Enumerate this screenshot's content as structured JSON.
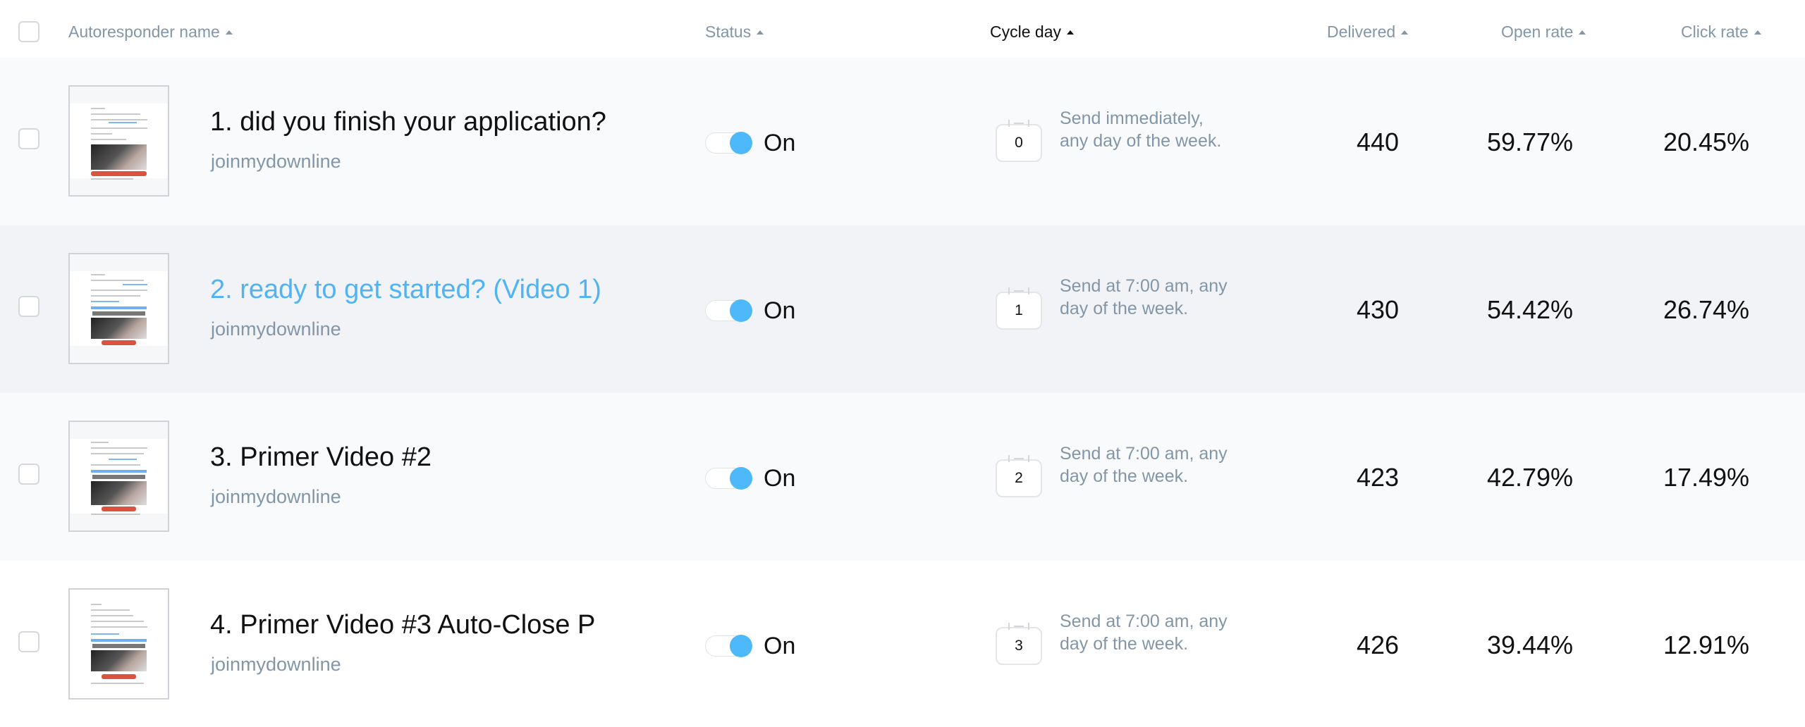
{
  "header": {
    "columns": [
      {
        "label": "Autoresponder name",
        "sorted": false
      },
      {
        "label": "Status",
        "sorted": false
      },
      {
        "label": "Cycle day",
        "sorted": true
      },
      {
        "label": "Delivered",
        "sorted": false
      },
      {
        "label": "Open rate",
        "sorted": false
      },
      {
        "label": "Click rate",
        "sorted": false
      }
    ]
  },
  "colors": {
    "accent": "#4db8fa",
    "link": "#4fb3f4",
    "muted": "#8396a8",
    "cta": "#d9533f"
  },
  "rows": [
    {
      "name": "1. did you finish your application?",
      "sender": "joinmydownline",
      "status": "On",
      "status_on": true,
      "cycle_day": "0",
      "schedule": "Send immediately, any day of the week.",
      "delivered": "440",
      "open_rate": "59.77%",
      "click_rate": "20.45%",
      "hovered": false
    },
    {
      "name": "2. ready to get started? (Video 1)",
      "sender": "joinmydownline",
      "status": "On",
      "status_on": true,
      "cycle_day": "1",
      "schedule": "Send at 7:00 am, any day of the week.",
      "delivered": "430",
      "open_rate": "54.42%",
      "click_rate": "26.74%",
      "hovered": true
    },
    {
      "name": "3. Primer Video #2",
      "sender": "joinmydownline",
      "status": "On",
      "status_on": true,
      "cycle_day": "2",
      "schedule": "Send at 7:00 am, any day of the week.",
      "delivered": "423",
      "open_rate": "42.79%",
      "click_rate": "17.49%",
      "hovered": false
    },
    {
      "name": "4. Primer Video #3 Auto-Close P",
      "sender": "joinmydownline",
      "status": "On",
      "status_on": true,
      "cycle_day": "3",
      "schedule": "Send at 7:00 am, any day of the week.",
      "delivered": "426",
      "open_rate": "39.44%",
      "click_rate": "12.91%",
      "hovered": false
    }
  ]
}
